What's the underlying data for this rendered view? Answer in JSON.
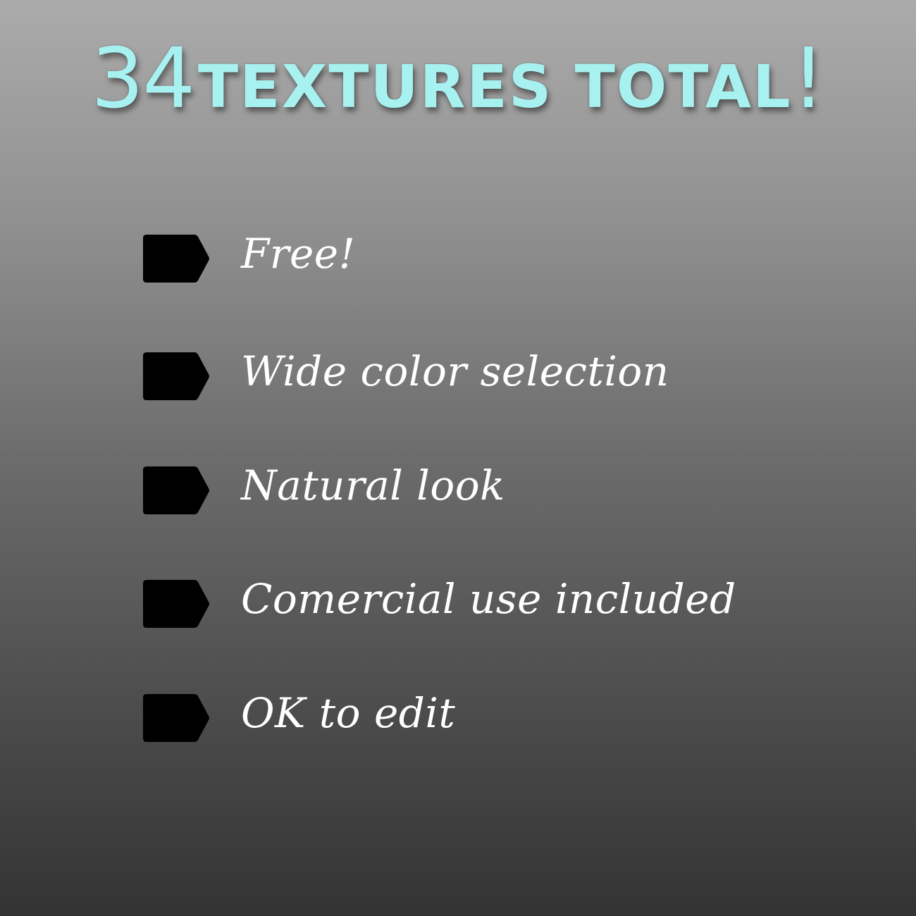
{
  "title": {
    "number": "34",
    "text": "TEXTURES TOTAL",
    "exclamation": "!"
  },
  "colors": {
    "title": "#a8f1f1",
    "label": "#ffffff",
    "tag": "#000000",
    "background_top": "#ababab",
    "background_bottom": "#333333"
  },
  "features": [
    {
      "icon": "tag-icon",
      "label": "Free!"
    },
    {
      "icon": "tag-icon",
      "label": "Wide color selection"
    },
    {
      "icon": "tag-icon",
      "label": "Natural look"
    },
    {
      "icon": "tag-icon",
      "label": "Comercial use included"
    },
    {
      "icon": "tag-icon",
      "label": "OK to edit"
    }
  ]
}
